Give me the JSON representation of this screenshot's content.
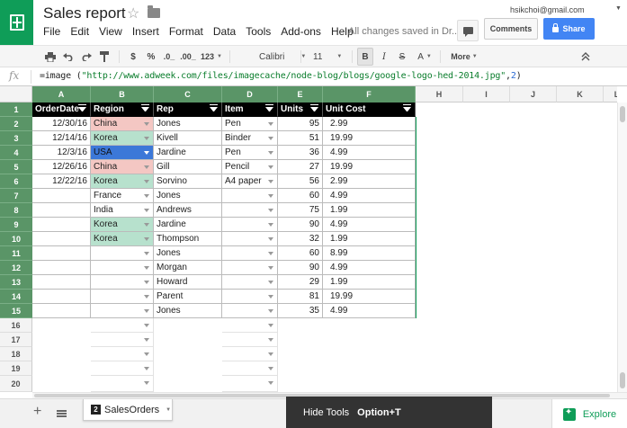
{
  "doc": {
    "title": "Sales report",
    "save_status": "All changes saved in Dr...",
    "user_email": "hsikchoi@gmail.com"
  },
  "menu": [
    "File",
    "Edit",
    "View",
    "Insert",
    "Format",
    "Data",
    "Tools",
    "Add-ons",
    "Help"
  ],
  "header_buttons": {
    "comments": "Comments",
    "share": "Share"
  },
  "toolbar": {
    "currency": "$",
    "percent": "%",
    "dec_decrease": ".0_",
    "dec_increase": ".00_",
    "number_format": "123",
    "font": "Calibri",
    "font_size": "11",
    "bold": "B",
    "italic": "I",
    "strike": "S",
    "text_color": "A",
    "more": "More"
  },
  "formula_bar": {
    "fx": "fx",
    "prefix": "=image (",
    "url": "\"http://www.adweek.com/files/imagecache/node-blog/blogs/google-logo-hed-2014.jpg\"",
    "comma": ",",
    "arg": "2",
    "suffix": ")"
  },
  "columns": [
    "A",
    "B",
    "C",
    "D",
    "E",
    "F",
    "H",
    "I",
    "J",
    "K",
    "L"
  ],
  "rows": [
    "1",
    "2",
    "3",
    "4",
    "5",
    "6",
    "7",
    "8",
    "9",
    "10",
    "11",
    "12",
    "13",
    "14",
    "15",
    "16",
    "17",
    "18",
    "19",
    "20"
  ],
  "table": {
    "headers": [
      "OrderDate",
      "Region",
      "Rep",
      "Item",
      "Units",
      "Unit Cost"
    ],
    "records": [
      [
        "12/30/16",
        "China",
        "Jones",
        "Pen",
        "95",
        "2.99"
      ],
      [
        "12/14/16",
        "Korea",
        "Kivell",
        "Binder",
        "51",
        "19.99"
      ],
      [
        "12/3/16",
        "USA",
        "Jardine",
        "Pen",
        "36",
        "4.99"
      ],
      [
        "12/26/16",
        "China",
        "Gill",
        "Pencil",
        "27",
        "19.99"
      ],
      [
        "12/22/16",
        "Korea",
        "Sorvino",
        "A4 paper",
        "56",
        "2.99"
      ],
      [
        "",
        "France",
        "Jones",
        "",
        "60",
        "4.99"
      ],
      [
        "",
        "India",
        "Andrews",
        "",
        "75",
        "1.99"
      ],
      [
        "",
        "Korea",
        "Jardine",
        "",
        "90",
        "4.99"
      ],
      [
        "",
        "Korea",
        "Thompson",
        "",
        "32",
        "1.99"
      ],
      [
        "",
        "",
        "Jones",
        "",
        "60",
        "8.99"
      ],
      [
        "",
        "",
        "Morgan",
        "",
        "90",
        "4.99"
      ],
      [
        "",
        "",
        "Howard",
        "",
        "29",
        "1.99"
      ],
      [
        "",
        "",
        "Parent",
        "",
        "81",
        "19.99"
      ],
      [
        "",
        "",
        "Jones",
        "",
        "35",
        "4.99"
      ]
    ]
  },
  "region_colors": {
    "China": "#f4c7c3",
    "Korea": "#b7e1cd",
    "USA": "#3c78d8"
  },
  "sheet_tab": {
    "index": "2",
    "name": "SalesOrders"
  },
  "tooltip": {
    "label": "Hide Tools",
    "shortcut": "Option+T"
  },
  "explore": "Explore",
  "icons": {
    "app": "sheets-logo-icon",
    "star": "star-icon",
    "folder": "folder-icon",
    "print": "print-icon",
    "undo": "undo-icon",
    "redo": "redo-icon",
    "paint_format": "paint-format-icon",
    "collapse": "chevron-up-icon"
  }
}
